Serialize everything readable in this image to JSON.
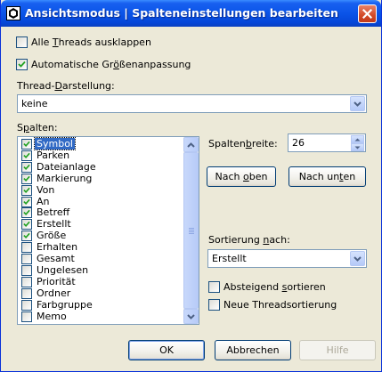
{
  "window": {
    "title": "Ansichtsmodus | Spalteneinstellungen bearbeiten"
  },
  "options": {
    "expand_all_threads": {
      "label_pre": "Alle ",
      "label_ul": "T",
      "label_post": "hreads ausklappen",
      "checked": false
    },
    "auto_size": {
      "label_pre": "Automatische Gr",
      "label_ul": "ö",
      "label_post": "ßenanpassung",
      "checked": true
    }
  },
  "thread_display": {
    "label_pre": "Thread-",
    "label_ul": "D",
    "label_post": "arstellung:",
    "value": "keine"
  },
  "columns": {
    "label_pre": "S",
    "label_ul": "p",
    "label_post": "alten:",
    "items": [
      {
        "label": "Symbol",
        "checked": true,
        "selected": true
      },
      {
        "label": "Parken",
        "checked": true
      },
      {
        "label": "Dateianlage",
        "checked": true
      },
      {
        "label": "Markierung",
        "checked": true
      },
      {
        "label": "Von",
        "checked": true
      },
      {
        "label": "An",
        "checked": true
      },
      {
        "label": "Betreff",
        "checked": true
      },
      {
        "label": "Erstellt",
        "checked": true
      },
      {
        "label": "Größe",
        "checked": true
      },
      {
        "label": "Erhalten",
        "checked": false
      },
      {
        "label": "Gesamt",
        "checked": false
      },
      {
        "label": "Ungelesen",
        "checked": false
      },
      {
        "label": "Priorität",
        "checked": false
      },
      {
        "label": "Ordner",
        "checked": false
      },
      {
        "label": "Farbgruppe",
        "checked": false
      },
      {
        "label": "Memo",
        "checked": false
      }
    ]
  },
  "column_width": {
    "label_pre": "Spalten",
    "label_ul": "b",
    "label_post": "reite:",
    "value": "26"
  },
  "move_up": {
    "label_pre": "Nach ",
    "label_ul": "o",
    "label_post": "ben"
  },
  "move_down": {
    "label_pre": "Nach un",
    "label_ul": "t",
    "label_post": "en"
  },
  "sort": {
    "label_pre": "Sortierung ",
    "label_ul": "n",
    "label_post": "ach:",
    "value": "Erstellt"
  },
  "descending": {
    "label_pre": "Absteigend ",
    "label_ul": "s",
    "label_post": "ortieren",
    "checked": false
  },
  "new_thread_sort": {
    "label_pre": "Neue Threadsortierung",
    "label_ul": "",
    "label_post": "",
    "checked": false
  },
  "footer": {
    "ok": "OK",
    "cancel": "Abbrechen",
    "help": "Hilfe"
  }
}
